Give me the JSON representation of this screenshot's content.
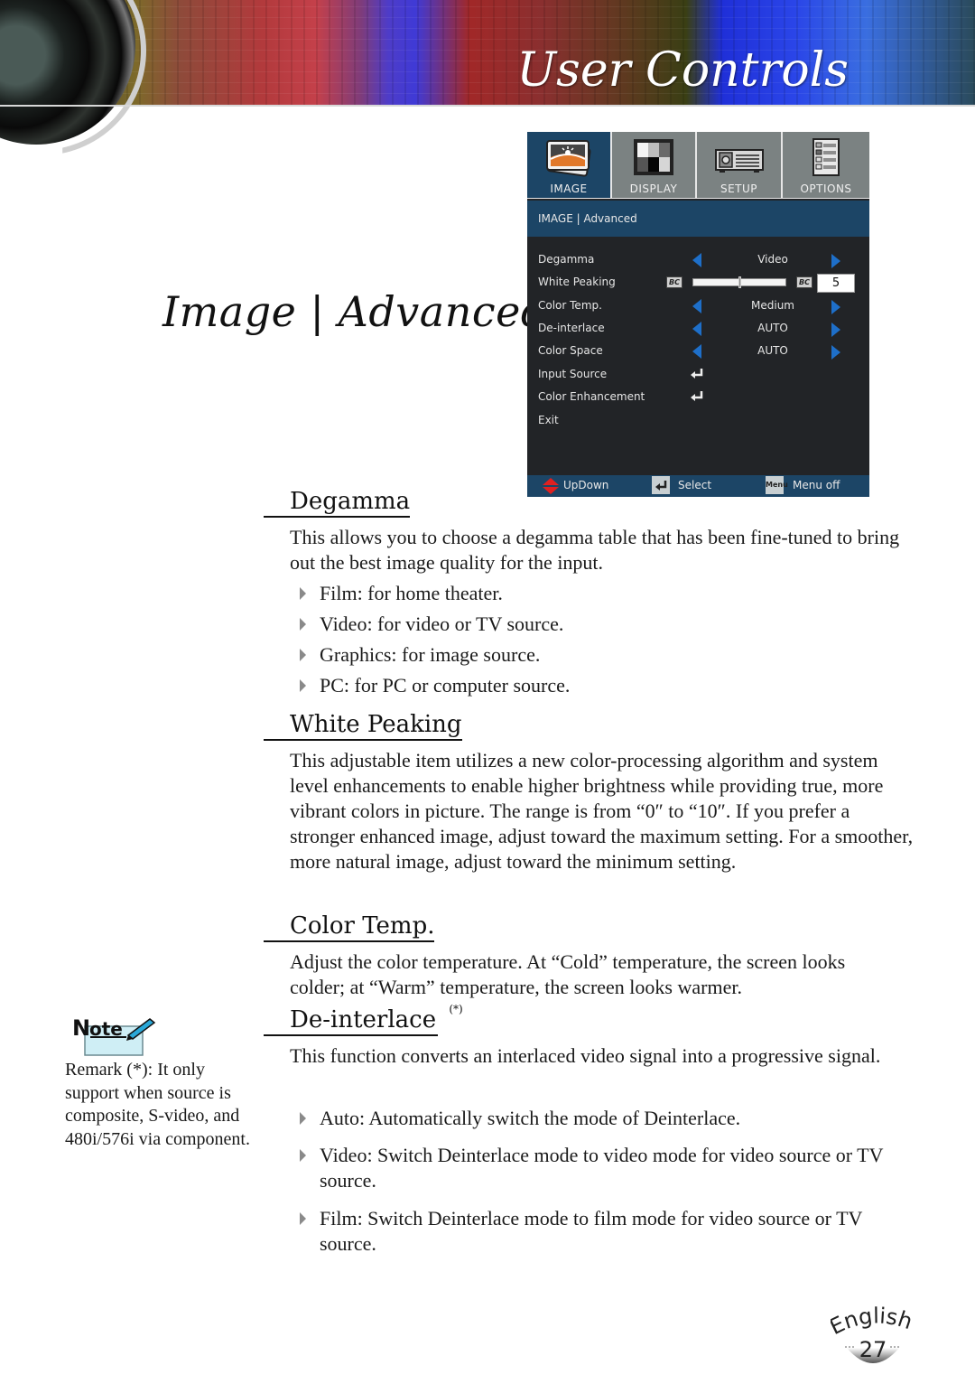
{
  "header": {
    "title": "User Controls"
  },
  "page_heading": "Image | Advanced",
  "osd": {
    "tabs": [
      {
        "label": "IMAGE",
        "icon": "image-icon",
        "active": true
      },
      {
        "label": "DISPLAY",
        "icon": "display-icon",
        "active": false
      },
      {
        "label": "SETUP",
        "icon": "projector-icon",
        "active": false
      },
      {
        "label": "OPTIONS",
        "icon": "options-list-icon",
        "active": false
      }
    ],
    "subtitle": "IMAGE | Advanced",
    "items": [
      {
        "label": "Degamma",
        "value": "Video",
        "type": "select"
      },
      {
        "label": "White Peaking",
        "value": "5",
        "type": "slider",
        "range": [
          0,
          10
        ]
      },
      {
        "label": "Color Temp.",
        "value": "Medium",
        "type": "select"
      },
      {
        "label": "De-interlace",
        "value": "AUTO",
        "type": "select"
      },
      {
        "label": "Color Space",
        "value": "AUTO",
        "type": "select"
      },
      {
        "label": "Input Source",
        "type": "submenu"
      },
      {
        "label": "Color Enhancement",
        "type": "submenu"
      },
      {
        "label": "Exit",
        "type": "action"
      }
    ],
    "footer": {
      "updown": "UpDown",
      "select": "Select",
      "menu_key": "Menu",
      "menu_off": "Menu off"
    },
    "colors": {
      "accent": "#1c4566",
      "arrow": "#1e6fc9",
      "background": "#222427",
      "inactive_tab": "#7b8282"
    }
  },
  "sections": {
    "degamma": {
      "title": "Degamma",
      "body": "This allows you to choose a degamma table that has been fine-tuned to bring out the best image quality for the input.",
      "bullets": [
        "Film: for home theater.",
        "Video: for video or TV source.",
        "Graphics: for image source.",
        "PC: for PC or computer source."
      ]
    },
    "white_peaking": {
      "title": "White Peaking",
      "body": "This adjustable item utilizes a new color-processing algorithm and system level enhancements to enable higher brightness while providing true, more vibrant colors in picture. The range is from “0″ to “10″. If you prefer a stronger enhanced image, adjust toward the maximum setting. For a smoother, more natural image, adjust toward the minimum setting."
    },
    "color_temp": {
      "title": "Color Temp.",
      "body": "Adjust the color temperature. At “Cold” temperature, the screen looks colder; at “Warm” temperature, the screen looks warmer."
    },
    "deinterlace": {
      "title": "De-interlace",
      "marker": "(*)",
      "body": "This function converts an interlaced video signal into a progressive signal.",
      "bullets": [
        "Auto: Automatically switch the mode of Deinterlace.",
        "Video: Switch Deinterlace mode to video mode for video source or TV source.",
        "Film: Switch Deinterlace mode to film mode for video source or TV source."
      ]
    }
  },
  "note": {
    "label": "Note",
    "text": "Remark (*): It only support when source is composite, S-video, and 480i/576i via component."
  },
  "footer": {
    "language": "English",
    "page_number": "27"
  }
}
